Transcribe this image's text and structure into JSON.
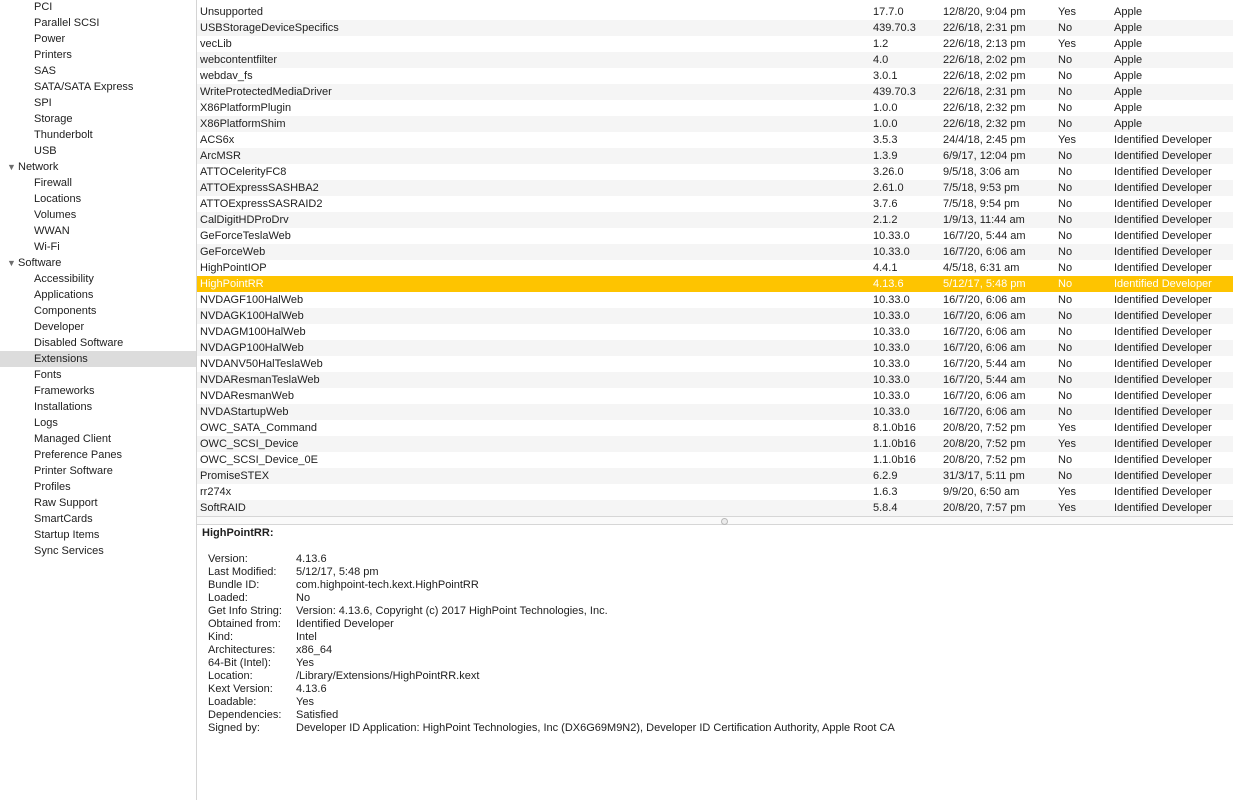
{
  "sidebar": {
    "items": [
      {
        "label": "PCI",
        "level": 1
      },
      {
        "label": "Parallel SCSI",
        "level": 1
      },
      {
        "label": "Power",
        "level": 1
      },
      {
        "label": "Printers",
        "level": 1
      },
      {
        "label": "SAS",
        "level": 1
      },
      {
        "label": "SATA/SATA Express",
        "level": 1
      },
      {
        "label": "SPI",
        "level": 1
      },
      {
        "label": "Storage",
        "level": 1
      },
      {
        "label": "Thunderbolt",
        "level": 1
      },
      {
        "label": "USB",
        "level": 1
      },
      {
        "label": "Network",
        "level": 0,
        "disclosure": "▼"
      },
      {
        "label": "Firewall",
        "level": 1
      },
      {
        "label": "Locations",
        "level": 1
      },
      {
        "label": "Volumes",
        "level": 1
      },
      {
        "label": "WWAN",
        "level": 1
      },
      {
        "label": "Wi-Fi",
        "level": 1
      },
      {
        "label": "Software",
        "level": 0,
        "disclosure": "▼"
      },
      {
        "label": "Accessibility",
        "level": 1
      },
      {
        "label": "Applications",
        "level": 1
      },
      {
        "label": "Components",
        "level": 1
      },
      {
        "label": "Developer",
        "level": 1
      },
      {
        "label": "Disabled Software",
        "level": 1
      },
      {
        "label": "Extensions",
        "level": 1,
        "selected": true
      },
      {
        "label": "Fonts",
        "level": 1
      },
      {
        "label": "Frameworks",
        "level": 1
      },
      {
        "label": "Installations",
        "level": 1
      },
      {
        "label": "Logs",
        "level": 1
      },
      {
        "label": "Managed Client",
        "level": 1
      },
      {
        "label": "Preference Panes",
        "level": 1
      },
      {
        "label": "Printer Software",
        "level": 1
      },
      {
        "label": "Profiles",
        "level": 1
      },
      {
        "label": "Raw Support",
        "level": 1
      },
      {
        "label": "SmartCards",
        "level": 1
      },
      {
        "label": "Startup Items",
        "level": 1
      },
      {
        "label": "Sync Services",
        "level": 1
      }
    ]
  },
  "table": {
    "rows": [
      {
        "name": "Unsupported",
        "version": "17.7.0",
        "modified": "12/8/20, 9:04 pm",
        "notarized": "Yes",
        "obtained": "Apple"
      },
      {
        "name": "USBStorageDeviceSpecifics",
        "version": "439.70.3",
        "modified": "22/6/18, 2:31 pm",
        "notarized": "No",
        "obtained": "Apple"
      },
      {
        "name": "vecLib",
        "version": "1.2",
        "modified": "22/6/18, 2:13 pm",
        "notarized": "Yes",
        "obtained": "Apple"
      },
      {
        "name": "webcontentfilter",
        "version": "4.0",
        "modified": "22/6/18, 2:02 pm",
        "notarized": "No",
        "obtained": "Apple"
      },
      {
        "name": "webdav_fs",
        "version": "3.0.1",
        "modified": "22/6/18, 2:02 pm",
        "notarized": "No",
        "obtained": "Apple"
      },
      {
        "name": "WriteProtectedMediaDriver",
        "version": "439.70.3",
        "modified": "22/6/18, 2:31 pm",
        "notarized": "No",
        "obtained": "Apple"
      },
      {
        "name": "X86PlatformPlugin",
        "version": "1.0.0",
        "modified": "22/6/18, 2:32 pm",
        "notarized": "No",
        "obtained": "Apple"
      },
      {
        "name": "X86PlatformShim",
        "version": "1.0.0",
        "modified": "22/6/18, 2:32 pm",
        "notarized": "No",
        "obtained": "Apple"
      },
      {
        "name": "ACS6x",
        "version": "3.5.3",
        "modified": "24/4/18, 2:45 pm",
        "notarized": "Yes",
        "obtained": "Identified Developer"
      },
      {
        "name": "ArcMSR",
        "version": "1.3.9",
        "modified": "6/9/17, 12:04 pm",
        "notarized": "No",
        "obtained": "Identified Developer"
      },
      {
        "name": "ATTOCelerityFC8",
        "version": "3.26.0",
        "modified": "9/5/18, 3:06 am",
        "notarized": "No",
        "obtained": "Identified Developer"
      },
      {
        "name": "ATTOExpressSASHBA2",
        "version": "2.61.0",
        "modified": "7/5/18, 9:53 pm",
        "notarized": "No",
        "obtained": "Identified Developer"
      },
      {
        "name": "ATTOExpressSASRAID2",
        "version": "3.7.6",
        "modified": "7/5/18, 9:54 pm",
        "notarized": "No",
        "obtained": "Identified Developer"
      },
      {
        "name": "CalDigitHDProDrv",
        "version": "2.1.2",
        "modified": "1/9/13, 11:44 am",
        "notarized": "No",
        "obtained": "Identified Developer"
      },
      {
        "name": "GeForceTeslaWeb",
        "version": "10.33.0",
        "modified": "16/7/20, 5:44 am",
        "notarized": "No",
        "obtained": "Identified Developer"
      },
      {
        "name": "GeForceWeb",
        "version": "10.33.0",
        "modified": "16/7/20, 6:06 am",
        "notarized": "No",
        "obtained": "Identified Developer"
      },
      {
        "name": "HighPointIOP",
        "version": "4.4.1",
        "modified": "4/5/18, 6:31 am",
        "notarized": "No",
        "obtained": "Identified Developer"
      },
      {
        "name": "HighPointRR",
        "version": "4.13.6",
        "modified": "5/12/17, 5:48 pm",
        "notarized": "No",
        "obtained": "Identified Developer",
        "selected": true
      },
      {
        "name": "NVDAGF100HalWeb",
        "version": "10.33.0",
        "modified": "16/7/20, 6:06 am",
        "notarized": "No",
        "obtained": "Identified Developer"
      },
      {
        "name": "NVDAGK100HalWeb",
        "version": "10.33.0",
        "modified": "16/7/20, 6:06 am",
        "notarized": "No",
        "obtained": "Identified Developer"
      },
      {
        "name": "NVDAGM100HalWeb",
        "version": "10.33.0",
        "modified": "16/7/20, 6:06 am",
        "notarized": "No",
        "obtained": "Identified Developer"
      },
      {
        "name": "NVDAGP100HalWeb",
        "version": "10.33.0",
        "modified": "16/7/20, 6:06 am",
        "notarized": "No",
        "obtained": "Identified Developer"
      },
      {
        "name": "NVDANV50HalTeslaWeb",
        "version": "10.33.0",
        "modified": "16/7/20, 5:44 am",
        "notarized": "No",
        "obtained": "Identified Developer"
      },
      {
        "name": "NVDAResmanTeslaWeb",
        "version": "10.33.0",
        "modified": "16/7/20, 5:44 am",
        "notarized": "No",
        "obtained": "Identified Developer"
      },
      {
        "name": "NVDAResmanWeb",
        "version": "10.33.0",
        "modified": "16/7/20, 6:06 am",
        "notarized": "No",
        "obtained": "Identified Developer"
      },
      {
        "name": "NVDAStartupWeb",
        "version": "10.33.0",
        "modified": "16/7/20, 6:06 am",
        "notarized": "No",
        "obtained": "Identified Developer"
      },
      {
        "name": "OWC_SATA_Command",
        "version": "8.1.0b16",
        "modified": "20/8/20, 7:52 pm",
        "notarized": "Yes",
        "obtained": "Identified Developer"
      },
      {
        "name": "OWC_SCSI_Device",
        "version": "1.1.0b16",
        "modified": "20/8/20, 7:52 pm",
        "notarized": "Yes",
        "obtained": "Identified Developer"
      },
      {
        "name": "OWC_SCSI_Device_0E",
        "version": "1.1.0b16",
        "modified": "20/8/20, 7:52 pm",
        "notarized": "No",
        "obtained": "Identified Developer"
      },
      {
        "name": "PromiseSTEX",
        "version": "6.2.9",
        "modified": "31/3/17, 5:11 pm",
        "notarized": "No",
        "obtained": "Identified Developer"
      },
      {
        "name": "rr274x",
        "version": "1.6.3",
        "modified": "9/9/20, 6:50 am",
        "notarized": "Yes",
        "obtained": "Identified Developer"
      },
      {
        "name": "SoftRAID",
        "version": "5.8.4",
        "modified": "20/8/20, 7:57 pm",
        "notarized": "Yes",
        "obtained": "Identified Developer"
      }
    ]
  },
  "detail": {
    "title": "HighPointRR:",
    "fields": [
      {
        "key": "Version:",
        "value": "4.13.6"
      },
      {
        "key": "Last Modified:",
        "value": "5/12/17, 5:48 pm"
      },
      {
        "key": "Bundle ID:",
        "value": "com.highpoint-tech.kext.HighPointRR"
      },
      {
        "key": "Loaded:",
        "value": "No"
      },
      {
        "key": "Get Info String:",
        "value": "Version: 4.13.6, Copyright (c) 2017 HighPoint Technologies, Inc."
      },
      {
        "key": "Obtained from:",
        "value": "Identified Developer"
      },
      {
        "key": "Kind:",
        "value": "Intel"
      },
      {
        "key": "Architectures:",
        "value": "x86_64"
      },
      {
        "key": "64-Bit (Intel):",
        "value": "Yes"
      },
      {
        "key": "Location:",
        "value": "/Library/Extensions/HighPointRR.kext"
      },
      {
        "key": "Kext Version:",
        "value": "4.13.6"
      },
      {
        "key": "Loadable:",
        "value": "Yes"
      },
      {
        "key": "Dependencies:",
        "value": "Satisfied"
      },
      {
        "key": "Signed by:",
        "value": "Developer ID Application: HighPoint Technologies, Inc (DX6G69M9N2), Developer ID Certification Authority, Apple Root CA"
      }
    ]
  },
  "colors": {
    "selection": "#fec400",
    "sidebar_selection": "#dcdcdc",
    "row_alt": "#f5f5f5"
  }
}
